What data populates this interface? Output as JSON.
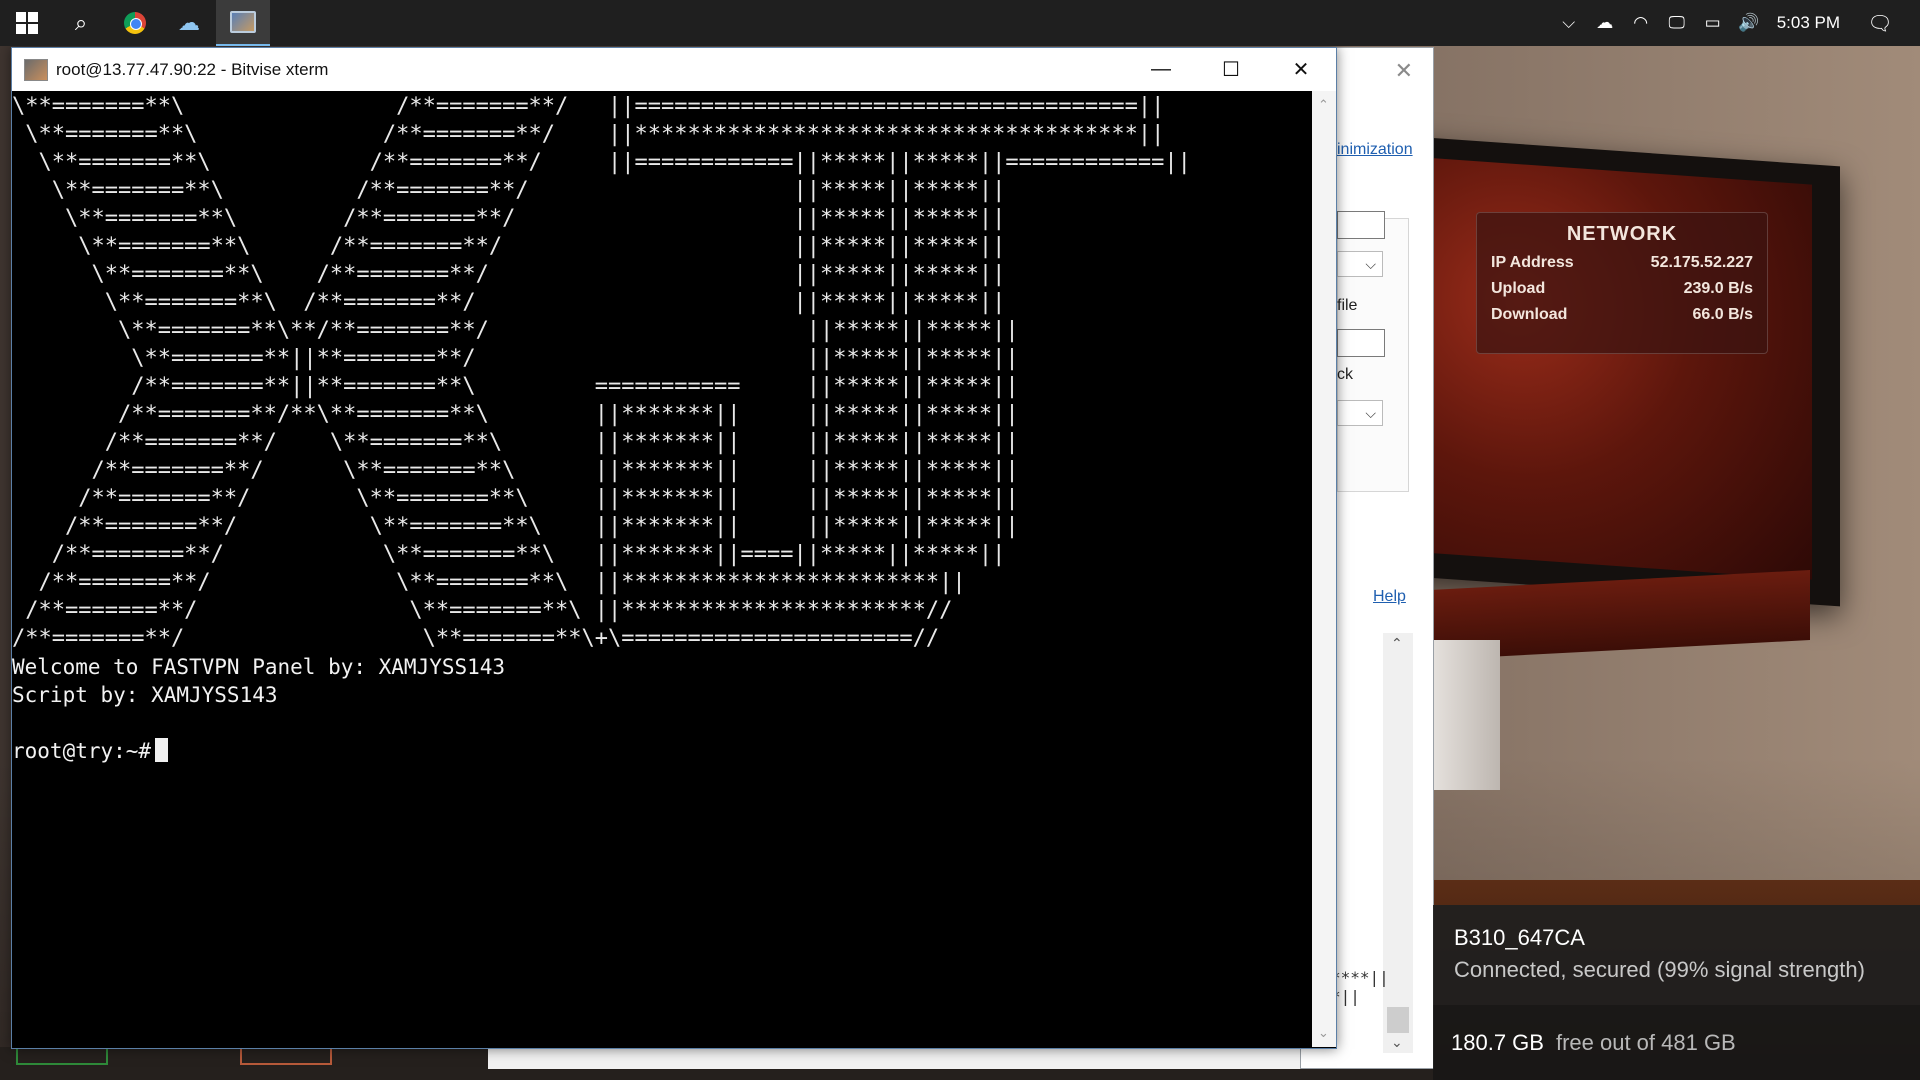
{
  "taskbar": {
    "start_icon": "windows-logo-icon",
    "search_icon": "search-icon",
    "apps": [
      "chrome-icon",
      "cloud-sync-icon",
      "bitvise-xterm-icon"
    ],
    "tray": {
      "chevron": "⌵",
      "cloud": "☁",
      "wifi": "◠",
      "network": "🖵",
      "battery": "▭",
      "volume": "🔊",
      "clock": "5:03 PM",
      "notifications": "🗨"
    }
  },
  "terminal": {
    "title": "root@13.77.47.90:22 - Bitvise xterm",
    "minimize": "—",
    "maximize": "☐",
    "close": "✕",
    "ascii_art": [
      "\\**=======**\\                /**=======**/   ||======================================||",
      " \\**=======**\\              /**=======**/    ||**************************************||",
      "  \\**=======**\\            /**=======**/     ||============||*****||*****||============||",
      "   \\**=======**\\          /**=======**/                    ||*****||*****||",
      "    \\**=======**\\        /**=======**/                     ||*****||*****||",
      "     \\**=======**\\      /**=======**/                      ||*****||*****||",
      "      \\**=======**\\    /**=======**/                       ||*****||*****||",
      "       \\**=======**\\  /**=======**/                        ||*****||*****||",
      "        \\**=======**\\**/**=======**/                        ||*****||*****||",
      "         \\**=======**||**=======**/                         ||*****||*****||",
      "         /**=======**||**=======**\\         ===========     ||*****||*****||",
      "        /**=======**/**\\**=======**\\        ||*******||     ||*****||*****||",
      "       /**=======**/    \\**=======**\\       ||*******||     ||*****||*****||",
      "      /**=======**/      \\**=======**\\      ||*******||     ||*****||*****||",
      "     /**=======**/        \\**=======**\\     ||*******||     ||*****||*****||",
      "    /**=======**/          \\**=======**\\    ||*******||     ||*****||*****||",
      "   /**=======**/            \\**=======**\\   ||*******||====||*****||*****||",
      "  /**=======**/              \\**=======**\\  ||************************||",
      " /**=======**/                \\**=======**\\ ||***********************//",
      "/**=======**/                  \\**=======**\\+\\======================//"
    ],
    "welcome": "Welcome to FASTVPN Panel by: XAMJYSS143",
    "script_by": "Script by: XAMJYSS143",
    "prompt": "root@try:~#"
  },
  "background_dialog": {
    "close": "✕",
    "link_top": "inimization",
    "label_file": "file",
    "label_ck": "ck",
    "select_arrow": "⌵",
    "help": "Help",
    "stars_line1": "****||",
    "stars_line2": "*||"
  },
  "network_widget": {
    "title": "NETWORK",
    "rows": [
      {
        "label": "IP Address",
        "value": "52.175.52.227"
      },
      {
        "label": "Upload",
        "value": "239.0 B/s"
      },
      {
        "label": "Download",
        "value": "66.0 B/s"
      }
    ]
  },
  "wifi": {
    "ssid": "B310_647CA",
    "status": "Connected, secured (99% signal strength)"
  },
  "drive": {
    "free": "180.7 GB",
    "label": "free out of 481 GB"
  }
}
